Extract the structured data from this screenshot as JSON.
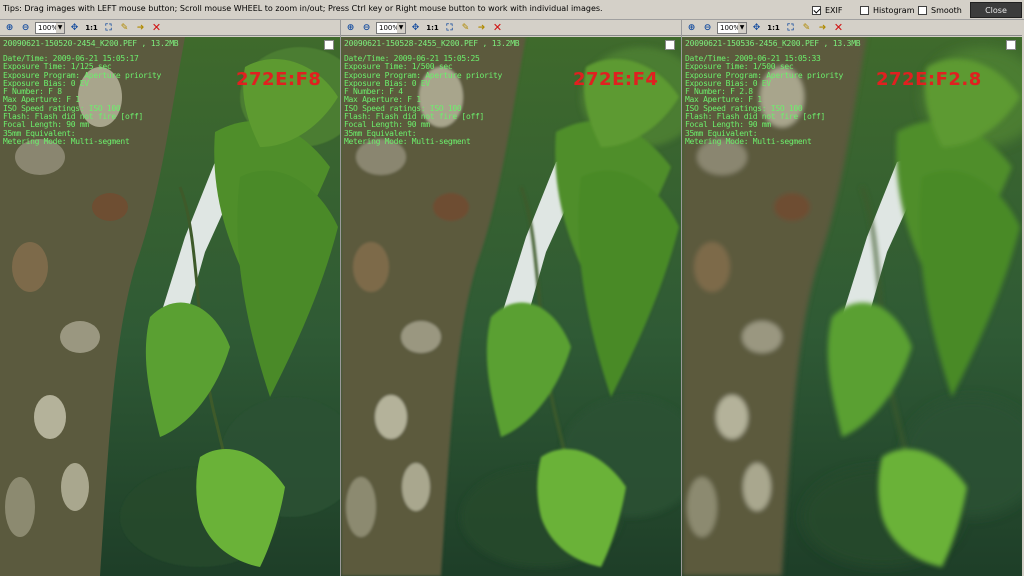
{
  "toolbar": {
    "tips": "Tips: Drag images with LEFT mouse button; Scroll mouse WHEEL to zoom in/out; Press Ctrl key or Right mouse button to work with individual images.",
    "exif_label": "EXIF",
    "exif_checked": true,
    "histogram_label": "Histogram",
    "histogram_checked": false,
    "smooth_label": "Smooth",
    "smooth_checked": false,
    "close_label": "Close"
  },
  "panel_toolbar": {
    "zoom_in_icon": "magnifier-plus-icon",
    "zoom_out_icon": "magnifier-minus-icon",
    "zoom_value": "100%",
    "one_to_one_label": "1:1"
  },
  "panels": [
    {
      "filename": "20090621-150520-2454_K200.PEF , 13.2MB",
      "tag": "272E:F8",
      "exif": [
        "Date/Time: 2009-06-21 15:05:17",
        "Exposure Time: 1/125 sec",
        "Exposure Program: Aperture priority",
        "Exposure Bias: 0 EV",
        "F Number: F 8",
        "Max Aperture: F 1",
        "ISO Speed ratings: ISO 100",
        "Flash: Flash did not fire [off]",
        "Focal Length: 90 mm",
        "35mm Equivalent:",
        "Metering Mode: Multi-segment"
      ]
    },
    {
      "filename": "20090621-150528-2455_K200.PEF , 13.2MB",
      "tag": "272E:F4",
      "exif": [
        "Date/Time: 2009-06-21 15:05:25",
        "Exposure Time: 1/500 sec",
        "Exposure Program: Aperture priority",
        "Exposure Bias: 0 EV",
        "F Number: F 4",
        "Max Aperture: F 1",
        "ISO Speed ratings: ISO 100",
        "Flash: Flash did not fire [off]",
        "Focal Length: 90 mm",
        "35mm Equivalent:",
        "Metering Mode: Multi-segment"
      ]
    },
    {
      "filename": "20090621-150536-2456_K200.PEF , 13.3MB",
      "tag": "272E:F2.8",
      "exif": [
        "Date/Time: 2009-06-21 15:05:33",
        "Exposure Time: 1/500 sec",
        "Exposure Program: Aperture priority",
        "Exposure Bias: 0 EV",
        "F Number: F 2.8",
        "Max Aperture: F 1",
        "ISO Speed ratings: ISO 100",
        "Flash: Flash did not fire [off]",
        "Focal Length: 90 mm",
        "35mm Equivalent:",
        "Metering Mode: Multi-segment"
      ]
    }
  ],
  "colors": {
    "exif_text": "#6cf06c",
    "tag_text": "#e02020",
    "bark": "#5b5a3e",
    "leaf": "#4f9a2a",
    "background_blur": "#2a4a30"
  }
}
